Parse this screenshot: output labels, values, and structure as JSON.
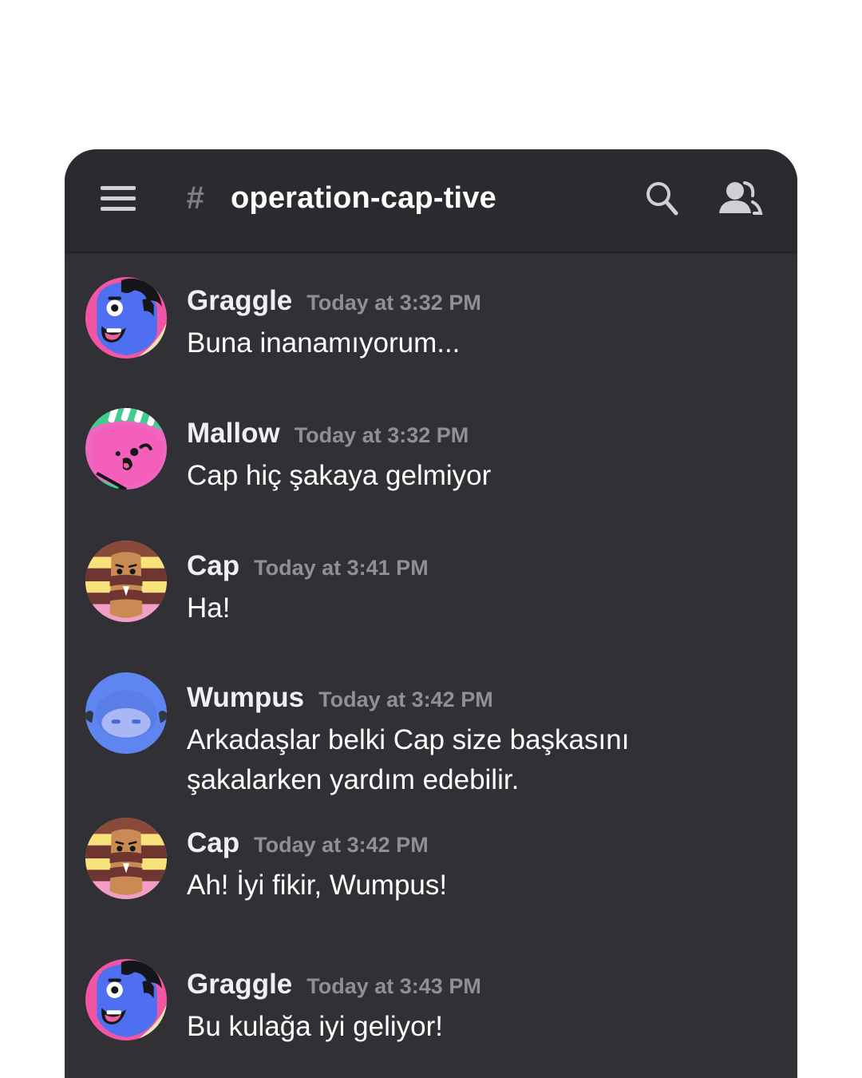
{
  "header": {
    "hash": "#",
    "channel_name": "operation-cap-tive",
    "icons": {
      "menu": "hamburger-menu-icon",
      "search": "search-icon",
      "members": "members-icon"
    }
  },
  "colors": {
    "app_background": "#303035",
    "header_background": "#2a2a2f",
    "username": "#f0f0f2",
    "timestamp": "#8e9097",
    "message_text": "#ffffff",
    "hash": "#7d7f86"
  },
  "messages": [
    {
      "username": "Graggle",
      "timestamp": "Today at 3:32 PM",
      "text": "Buna inanamıyorum...",
      "avatar": "graggle-avatar"
    },
    {
      "username": "Mallow",
      "timestamp": "Today at 3:32 PM",
      "text": "Cap hiç şakaya gelmiyor",
      "avatar": "mallow-avatar"
    },
    {
      "username": "Cap",
      "timestamp": "Today at 3:41 PM",
      "text": "Ha!",
      "avatar": "cap-avatar"
    },
    {
      "username": "Wumpus",
      "timestamp": "Today at 3:42 PM",
      "text": "Arkadaşlar belki Cap size başkasını şakalarken yardım edebilir.",
      "avatar": "wumpus-avatar"
    },
    {
      "username": "Cap",
      "timestamp": "Today at 3:42 PM",
      "text": "Ah! İyi fikir, Wumpus!",
      "avatar": "cap-avatar"
    },
    {
      "username": "Graggle",
      "timestamp": "Today at 3:43 PM",
      "text": "Bu kulağa iyi geliyor!",
      "avatar": "graggle-avatar"
    }
  ]
}
